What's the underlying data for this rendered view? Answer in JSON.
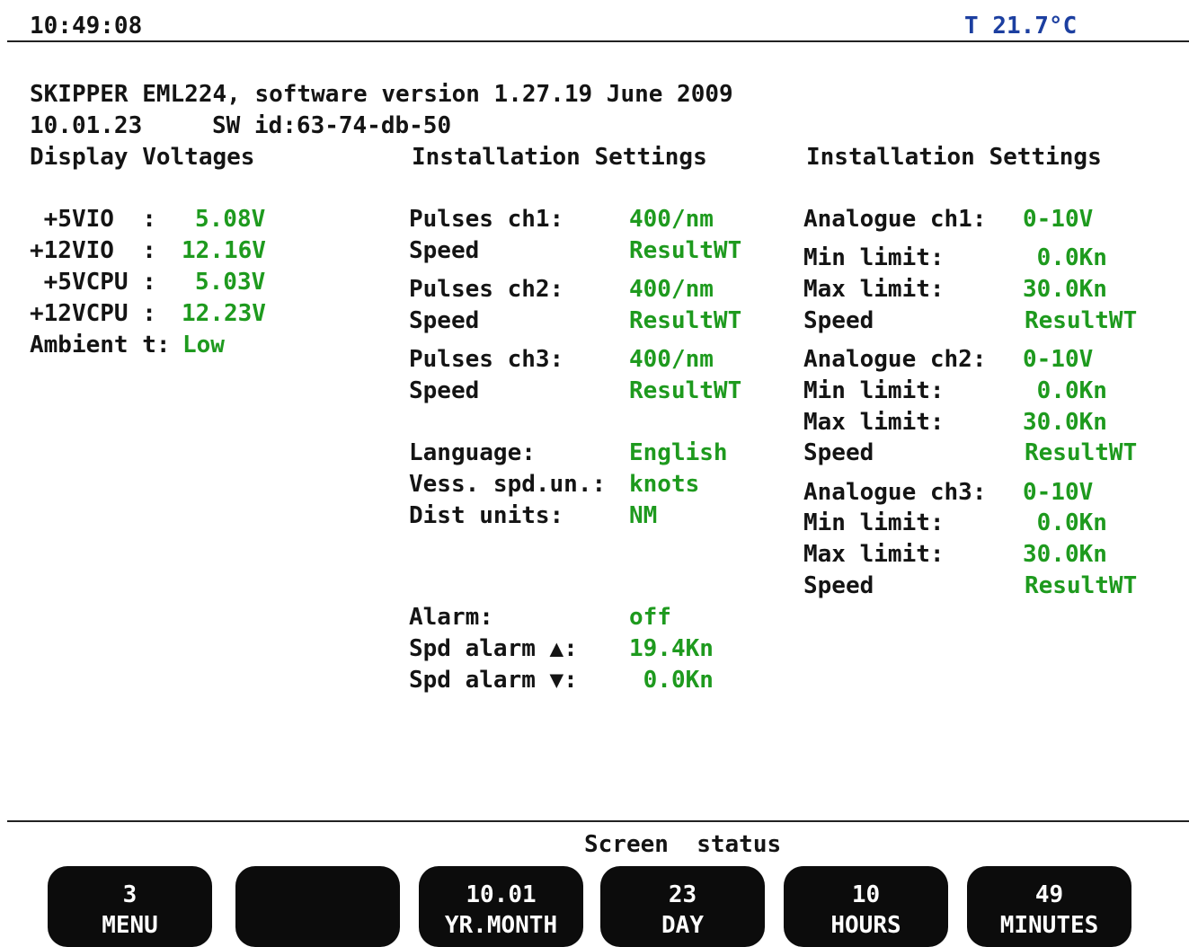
{
  "header": {
    "time": "10:49:08",
    "temperature": "T 21.7°C"
  },
  "info": {
    "title": "SKIPPER EML224, software version 1.27.19 June 2009",
    "date": "10.01.23",
    "sw_id": "SW id:63-74-db-50"
  },
  "voltages": {
    "heading": "Display Voltages",
    "rows": [
      {
        "label": " +5VIO  : ",
        "value": "5.08V"
      },
      {
        "label": "+12VIO  : ",
        "value": "12.16V"
      },
      {
        "label": " +5VCPU : ",
        "value": "5.03V"
      },
      {
        "label": "+12VCPU : ",
        "value": "12.23V"
      },
      {
        "label": "Ambient t:",
        "value": "Low"
      }
    ]
  },
  "installation1": {
    "heading": "Installation Settings",
    "rows": [
      {
        "label": "Pulses ch1:",
        "value": "400/nm"
      },
      {
        "label": "Speed",
        "value": "ResultWT"
      },
      {
        "label": "Pulses ch2:",
        "value": "400/nm"
      },
      {
        "label": "Speed",
        "value": "ResultWT"
      },
      {
        "label": "Pulses ch3:",
        "value": "400/nm"
      },
      {
        "label": "Speed",
        "value": "ResultWT"
      },
      {
        "label": "Language:",
        "value": "English"
      },
      {
        "label": "Vess. spd.un.:",
        "value": "knots"
      },
      {
        "label": "Dist units:",
        "value": "NM"
      },
      {
        "label": "Alarm:",
        "value": "off"
      },
      {
        "label": "Spd alarm ▲:",
        "value": "19.4Kn"
      },
      {
        "label": "Spd alarm ▼:",
        "value": " 0.0Kn"
      }
    ]
  },
  "installation2": {
    "heading": "Installation Settings",
    "rows": [
      {
        "label": "Analogue ch1:",
        "value": "0-10V"
      },
      {
        "label": "Min limit:",
        "value": " 0.0Kn"
      },
      {
        "label": "Max limit:",
        "value": "30.0Kn"
      },
      {
        "label": "Speed",
        "value": "ResultWT"
      },
      {
        "label": "Analogue ch2:",
        "value": "0-10V"
      },
      {
        "label": "Min limit:",
        "value": " 0.0Kn"
      },
      {
        "label": "Max limit:",
        "value": "30.0Kn"
      },
      {
        "label": "Speed",
        "value": "ResultWT"
      },
      {
        "label": "Analogue ch3:",
        "value": "0-10V"
      },
      {
        "label": "Min limit:",
        "value": " 0.0Kn"
      },
      {
        "label": "Max limit:",
        "value": "30.0Kn"
      },
      {
        "label": "Speed",
        "value": "ResultWT"
      }
    ]
  },
  "footer": {
    "status_label": "Screen  status",
    "softkeys": [
      {
        "top": "3",
        "bottom": "MENU"
      },
      {
        "top": "",
        "bottom": ""
      },
      {
        "top": "10.01",
        "bottom": "YR.MONTH"
      },
      {
        "top": "23",
        "bottom": "DAY"
      },
      {
        "top": "10",
        "bottom": "HOURS"
      },
      {
        "top": "49",
        "bottom": "MINUTES"
      }
    ]
  }
}
